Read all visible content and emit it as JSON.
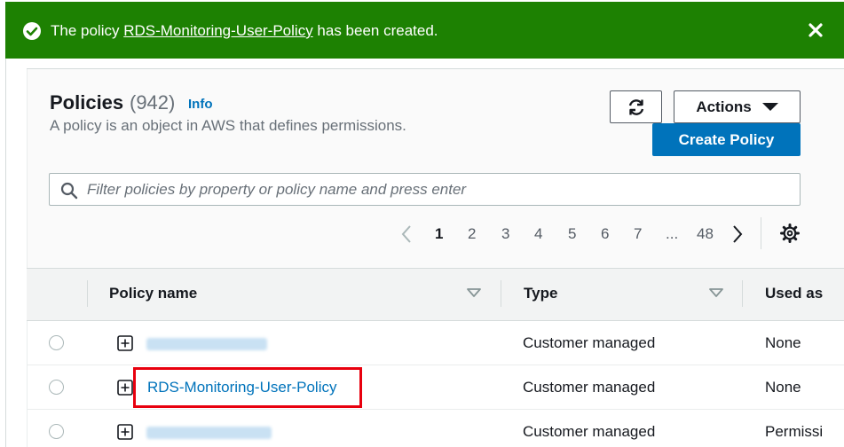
{
  "flash": {
    "prefix": "The policy ",
    "policy_name": "RDS-Monitoring-User-Policy",
    "suffix": " has been created."
  },
  "header": {
    "title": "Policies",
    "count": "(942)",
    "info": "Info",
    "description": "A policy is an object in AWS that defines permissions."
  },
  "toolbar": {
    "actions_label": "Actions",
    "create_label": "Create Policy"
  },
  "search": {
    "placeholder": "Filter policies by property or policy name and press enter",
    "value": ""
  },
  "pagination": {
    "pages": [
      "1",
      "2",
      "3",
      "4",
      "5",
      "6",
      "7",
      "...",
      "48"
    ],
    "current": "1"
  },
  "table": {
    "columns": [
      "Policy name",
      "Type",
      "Used as"
    ],
    "rows": [
      {
        "name": "",
        "type": "Customer managed",
        "used_as": "None"
      },
      {
        "name": "RDS-Monitoring-User-Policy",
        "type": "Customer managed",
        "used_as": "None"
      },
      {
        "name": "",
        "type": "Customer managed",
        "used_as": "Permissi"
      }
    ]
  },
  "colors": {
    "success": "#1d8102",
    "link": "#0073bb",
    "primary_button": "#0073bb",
    "highlight_box": "#e8000e"
  },
  "icons": [
    "check-circle-icon",
    "close-icon",
    "refresh-icon",
    "caret-down-icon",
    "search-icon",
    "chevron-left-icon",
    "chevron-right-icon",
    "settings-gear-icon",
    "sort-caret-icon",
    "expand-plus-icon"
  ]
}
